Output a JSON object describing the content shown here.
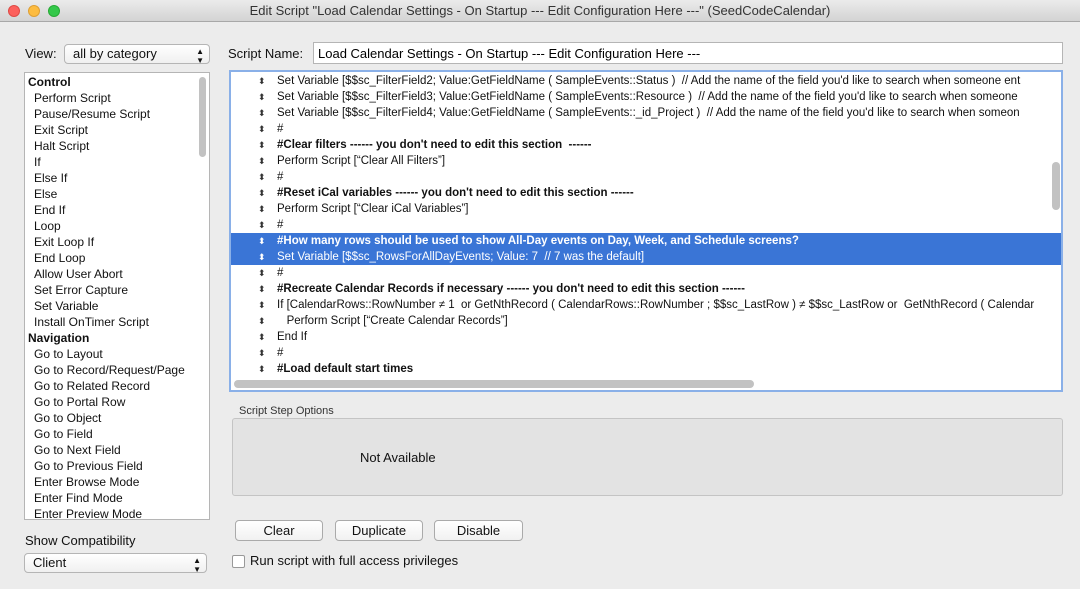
{
  "window": {
    "title": "Edit Script \"Load Calendar Settings - On Startup --- Edit Configuration Here ---\" (SeedCodeCalendar)"
  },
  "view": {
    "label": "View:",
    "value": "all by category"
  },
  "steps": [
    {
      "t": "cat",
      "l": "Control"
    },
    {
      "l": "Perform Script"
    },
    {
      "l": "Pause/Resume Script"
    },
    {
      "l": "Exit Script"
    },
    {
      "l": "Halt Script"
    },
    {
      "l": "If"
    },
    {
      "l": "Else If"
    },
    {
      "l": "Else"
    },
    {
      "l": "End If"
    },
    {
      "l": "Loop"
    },
    {
      "l": "Exit Loop If"
    },
    {
      "l": "End Loop"
    },
    {
      "l": "Allow User Abort"
    },
    {
      "l": "Set Error Capture"
    },
    {
      "l": "Set Variable"
    },
    {
      "l": "Install OnTimer Script"
    },
    {
      "t": "cat",
      "l": "Navigation"
    },
    {
      "l": "Go to Layout"
    },
    {
      "l": "Go to Record/Request/Page"
    },
    {
      "l": "Go to Related Record"
    },
    {
      "l": "Go to Portal Row"
    },
    {
      "l": "Go to Object"
    },
    {
      "l": "Go to Field"
    },
    {
      "l": "Go to Next Field"
    },
    {
      "l": "Go to Previous Field"
    },
    {
      "l": "Enter Browse Mode"
    },
    {
      "l": "Enter Find Mode"
    },
    {
      "l": "Enter Preview Mode"
    }
  ],
  "compat": {
    "label": "Show Compatibility",
    "value": "Client"
  },
  "script_name": {
    "label": "Script Name:",
    "value": "Load Calendar Settings - On Startup --- Edit Configuration Here ---"
  },
  "lines": [
    {
      "l": "Set Variable [$$sc_FilterField2; Value:GetFieldName ( SampleEvents::Status )  // Add the name of the field you'd like to search when someone ent"
    },
    {
      "l": "Set Variable [$$sc_FilterField3; Value:GetFieldName ( SampleEvents::Resource )  // Add the name of the field you'd like to search when someone"
    },
    {
      "l": "Set Variable [$$sc_FilterField4; Value:GetFieldName ( SampleEvents::_id_Project )  // Add the name of the field you'd like to search when someon"
    },
    {
      "l": "#"
    },
    {
      "l": "#Clear filters ------ you don't need to edit this section  ------",
      "b": true
    },
    {
      "l": "Perform Script [“Clear All Filters”]"
    },
    {
      "l": "#"
    },
    {
      "l": "#Reset iCal variables ------ you don't need to edit this section ------",
      "b": true
    },
    {
      "l": "Perform Script [“Clear iCal Variables”]"
    },
    {
      "l": "#"
    },
    {
      "l": "#How many rows should be used to show All-Day events on Day, Week, and Schedule screens?",
      "b": true,
      "sel": true
    },
    {
      "l": "Set Variable [$$sc_RowsForAllDayEvents; Value: 7  // 7 was the default]",
      "sel": true
    },
    {
      "l": "#"
    },
    {
      "l": "#Recreate Calendar Records if necessary ------ you don't need to edit this section ------",
      "b": true
    },
    {
      "l": "If [CalendarRows::RowNumber ≠ 1  or GetNthRecord ( CalendarRows::RowNumber ; $$sc_LastRow ) ≠ $$sc_LastRow or  GetNthRecord ( Calendar"
    },
    {
      "l": "   Perform Script [“Create Calendar Records”]"
    },
    {
      "l": "End If"
    },
    {
      "l": "#"
    },
    {
      "l": "#Load default start times",
      "b": true
    }
  ],
  "options": {
    "label": "Script Step Options",
    "message": "Not Available"
  },
  "buttons": {
    "clear": "Clear",
    "duplicate": "Duplicate",
    "disable": "Disable"
  },
  "full_access": {
    "label": "Run script with full access privileges",
    "checked": false
  },
  "colors": {
    "selection": "#3a75d6",
    "focus_ring": "#8ab0e8"
  }
}
